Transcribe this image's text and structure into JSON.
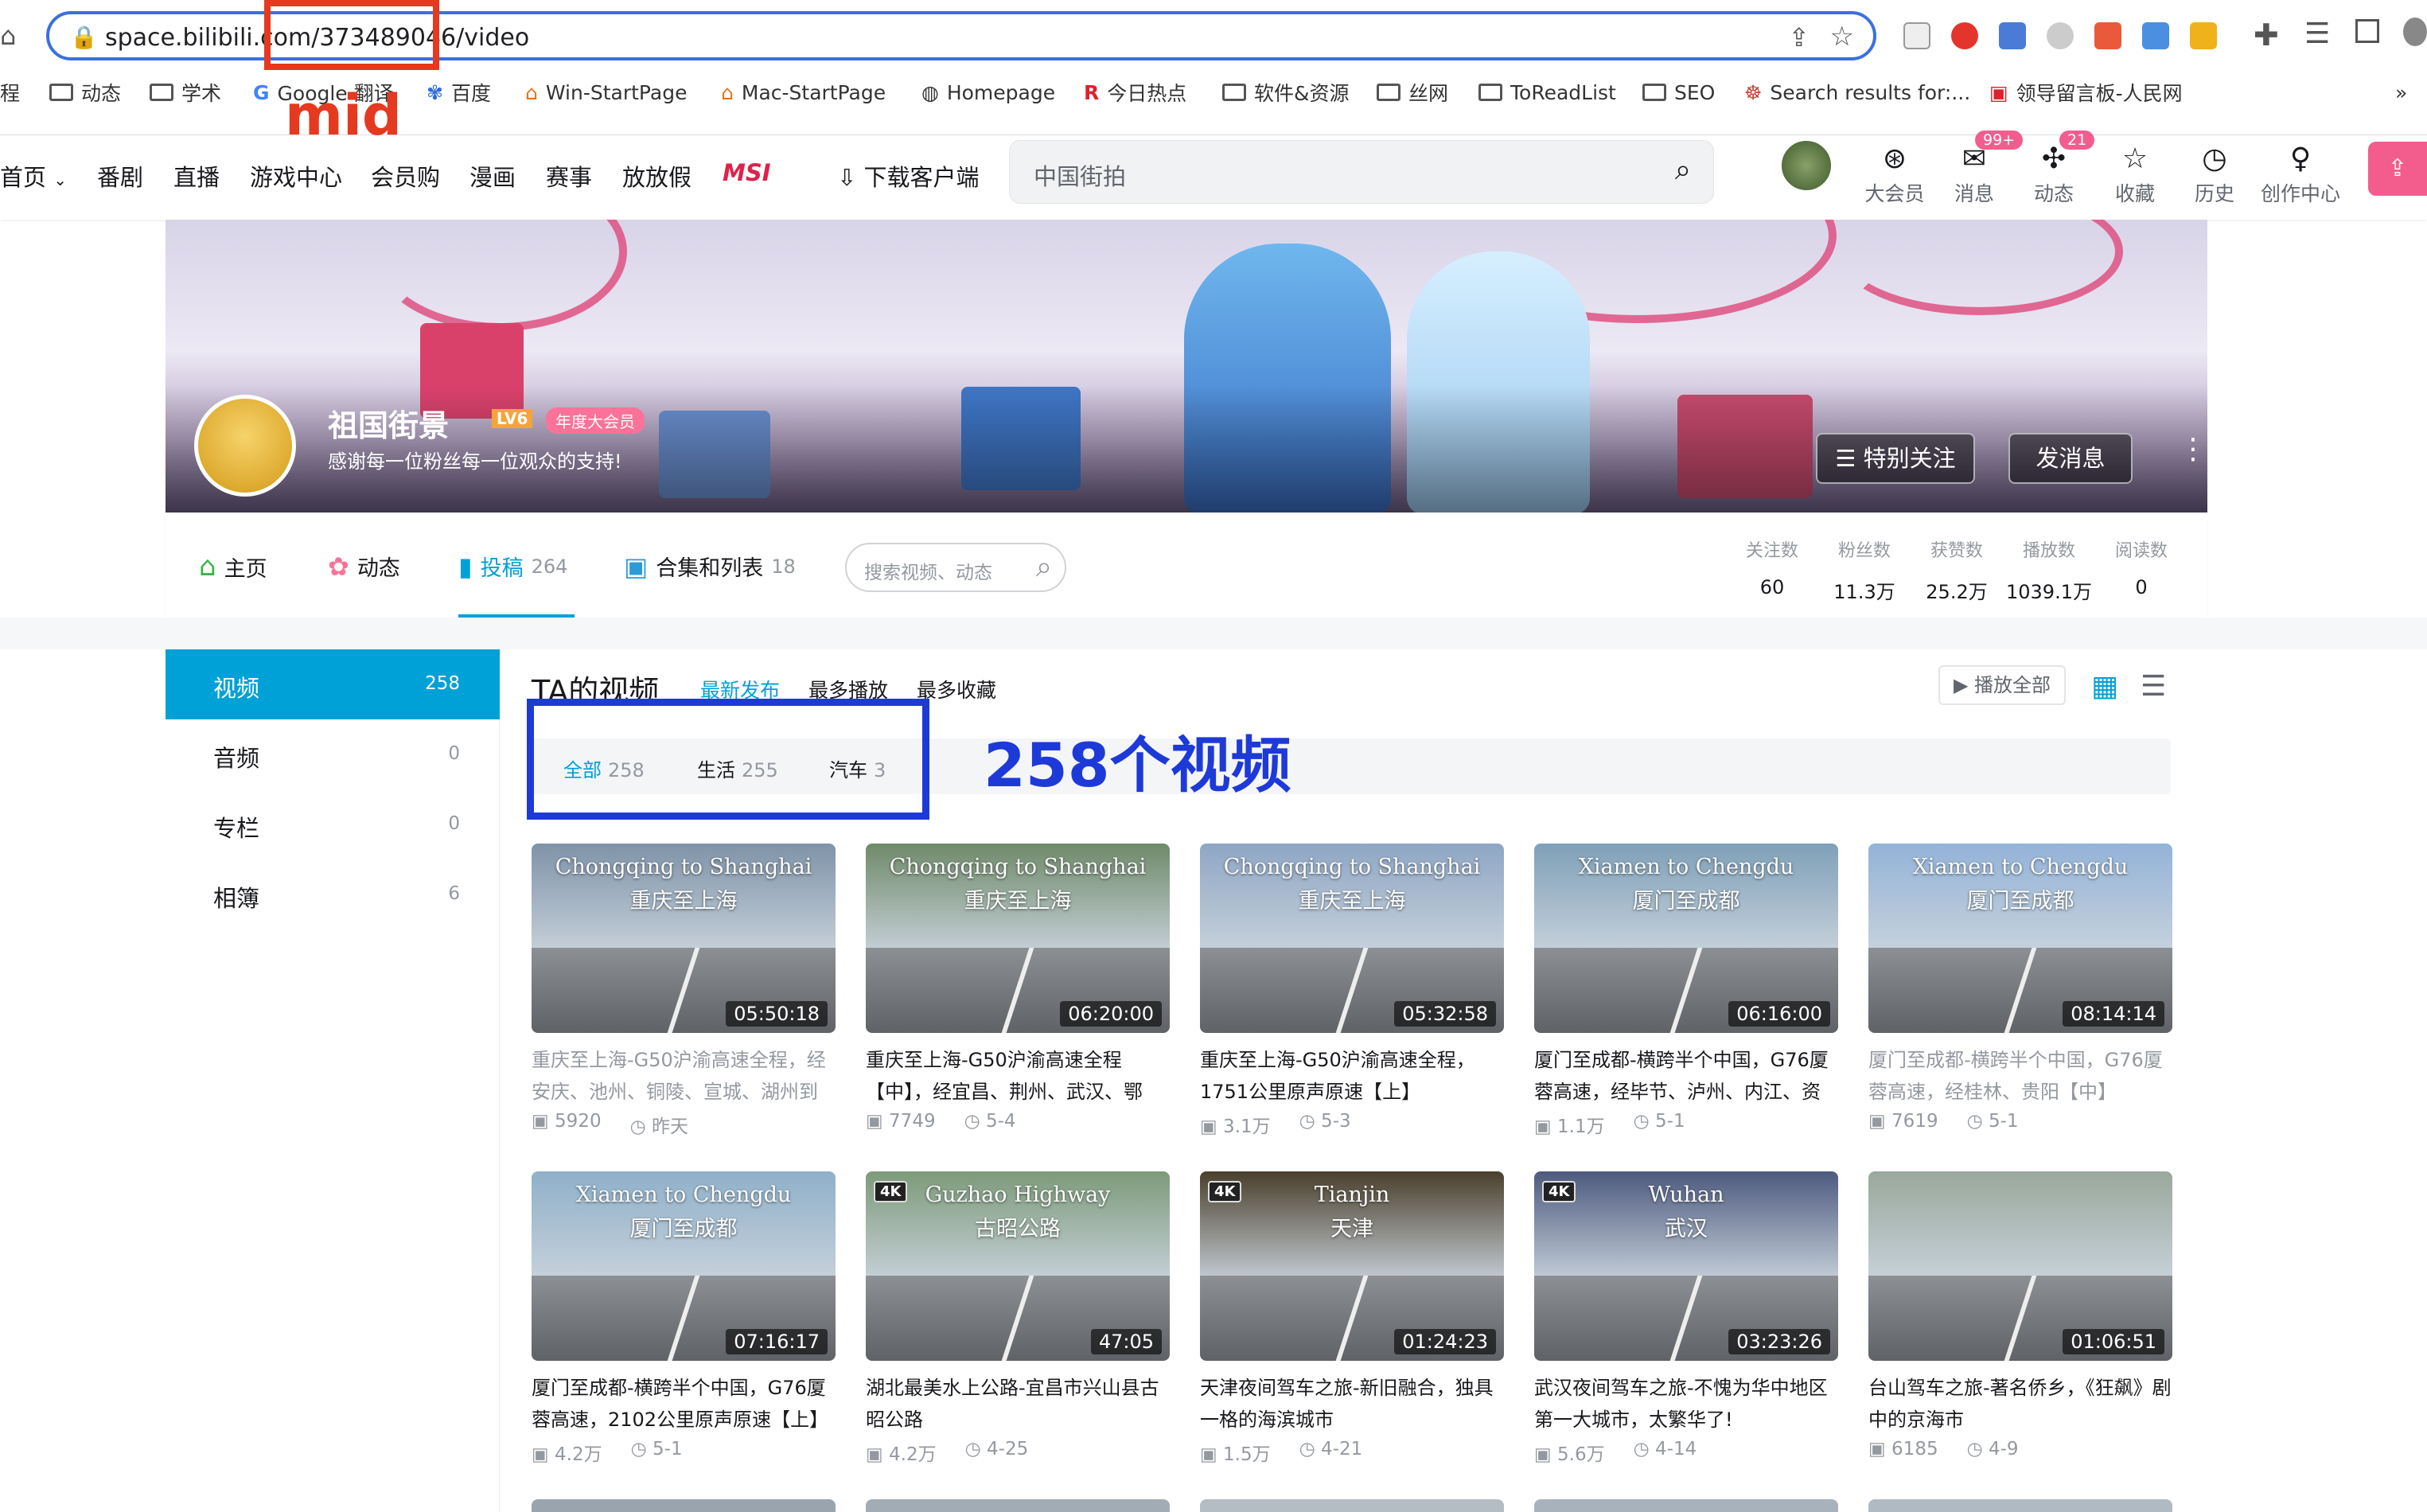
{
  "browser": {
    "url": "space.bilibili.com/373489046/video",
    "bookmarks": [
      "程",
      "动态",
      "学术",
      "Google 翻译",
      "百度",
      "Win-StartPage",
      "Mac-StartPage",
      "Homepage",
      "今日热点",
      "软件&资源",
      "丝网",
      "ToReadList",
      "SEO",
      "Search results for:...",
      "领导留言板-人民网"
    ],
    "overflow": "»"
  },
  "annotations": {
    "url_label": "mid",
    "count_label": "258个视频"
  },
  "site_nav": {
    "items": [
      "首页",
      "番剧",
      "直播",
      "游戏中心",
      "会员购",
      "漫画",
      "赛事",
      "放放假",
      "MSI",
      "下载客户端"
    ],
    "search_placeholder": "中国街拍",
    "icons": [
      {
        "label": "大会员",
        "icon": "vip-icon"
      },
      {
        "label": "消息",
        "icon": "message-icon",
        "badge": "99+"
      },
      {
        "label": "动态",
        "icon": "dynamic-icon",
        "badge": "21"
      },
      {
        "label": "收藏",
        "icon": "star-icon"
      },
      {
        "label": "历史",
        "icon": "clock-icon"
      },
      {
        "label": "创作中心",
        "icon": "bulb-icon"
      }
    ]
  },
  "profile": {
    "name": "祖国街景",
    "level": "LV6",
    "vip": "年度大会员",
    "signature": "感谢每一位粉丝每一位观众的支持!",
    "follow_btn": "特别关注",
    "message_btn": "发消息"
  },
  "tabs": [
    {
      "label": "主页",
      "count": ""
    },
    {
      "label": "动态",
      "count": ""
    },
    {
      "label": "投稿",
      "count": "264"
    },
    {
      "label": "合集和列表",
      "count": "18"
    }
  ],
  "profile_search_placeholder": "搜索视频、动态",
  "stats": [
    {
      "label": "关注数",
      "value": "60"
    },
    {
      "label": "粉丝数",
      "value": "11.3万"
    },
    {
      "label": "获赞数",
      "value": "25.2万"
    },
    {
      "label": "播放数",
      "value": "1039.1万"
    },
    {
      "label": "阅读数",
      "value": "0"
    }
  ],
  "sidebar": [
    {
      "label": "视频",
      "count": "258"
    },
    {
      "label": "音频",
      "count": "0"
    },
    {
      "label": "专栏",
      "count": "0"
    },
    {
      "label": "相簿",
      "count": "6"
    }
  ],
  "section": {
    "title": "TA的视频",
    "sorts": [
      "最新发布",
      "最多播放",
      "最多收藏"
    ],
    "play_all": "播放全部"
  },
  "filters": [
    {
      "label": "全部",
      "count": "258"
    },
    {
      "label": "生活",
      "count": "255"
    },
    {
      "label": "汽车",
      "count": "3"
    }
  ],
  "videos": [
    {
      "t1": "Chongqing to Shanghai",
      "t2": "重庆至上海",
      "dur": "05:50:18",
      "title": "重庆至上海-G50沪渝高速全程，经安庆、池州、铜陵、宣城、湖州到",
      "views": "5920",
      "date": "昨天",
      "visited": true,
      "sky": "#7f93a8",
      "k4": false
    },
    {
      "t1": "Chongqing to Shanghai",
      "t2": "重庆至上海",
      "dur": "06:20:00",
      "title": "重庆至上海-G50沪渝高速全程【中】，经宜昌、荆州、武汉、鄂",
      "views": "7749",
      "date": "5-4",
      "visited": false,
      "sky": "#6f8a6a",
      "k4": false
    },
    {
      "t1": "Chongqing to Shanghai",
      "t2": "重庆至上海",
      "dur": "05:32:58",
      "title": "重庆至上海-G50沪渝高速全程，1751公里原声原速【上】",
      "views": "3.1万",
      "date": "5-3",
      "visited": false,
      "sky": "#8ea6c4",
      "k4": false
    },
    {
      "t1": "Xiamen to Chengdu",
      "t2": "厦门至成都",
      "dur": "06:16:00",
      "title": "厦门至成都-横跨半个中国，G76厦蓉高速，经毕节、泸州、内江、资",
      "views": "1.1万",
      "date": "5-1",
      "visited": false,
      "sky": "#7fa0b8",
      "k4": false
    },
    {
      "t1": "Xiamen to Chengdu",
      "t2": "厦门至成都",
      "dur": "08:14:14",
      "title": "厦门至成都-横跨半个中国，G76厦蓉高速，经桂林、贵阳【中】",
      "views": "7619",
      "date": "5-1",
      "visited": true,
      "sky": "#93b3d8",
      "k4": false
    },
    {
      "t1": "Xiamen to Chengdu",
      "t2": "厦门至成都",
      "dur": "07:16:17",
      "title": "厦门至成都-横跨半个中国，G76厦蓉高速，2102公里原声原速【上】",
      "views": "4.2万",
      "date": "5-1",
      "visited": false,
      "sky": "#8fb0c9",
      "k4": false
    },
    {
      "t1": "Guzhao Highway",
      "t2": "古昭公路",
      "dur": "47:05",
      "title": "湖北最美水上公路-宜昌市兴山县古昭公路",
      "views": "4.2万",
      "date": "4-25",
      "visited": false,
      "sky": "#7d9a7a",
      "k4": true
    },
    {
      "t1": "Tianjin",
      "t2": "天津",
      "dur": "01:24:23",
      "title": "天津夜间驾车之旅-新旧融合，独具一格的海滨城市",
      "views": "1.5万",
      "date": "4-21",
      "visited": false,
      "sky": "#4a3f2c",
      "k4": true
    },
    {
      "t1": "Wuhan",
      "t2": "武汉",
      "dur": "03:23:26",
      "title": "武汉夜间驾车之旅-不愧为华中地区第一大城市，太繁华了!",
      "views": "5.6万",
      "date": "4-14",
      "visited": false,
      "sky": "#4d5a7e",
      "k4": true
    },
    {
      "t1": "",
      "t2": "",
      "dur": "01:06:51",
      "title": "台山驾车之旅-著名侨乡，《狂飙》剧中的京海市",
      "views": "6185",
      "date": "4-9",
      "visited": false,
      "sky": "#9aa89c",
      "k4": false
    }
  ],
  "colors": {
    "accent": "#00a1d6",
    "annotation_red": "#e53920",
    "annotation_blue": "#1d3ad8"
  }
}
